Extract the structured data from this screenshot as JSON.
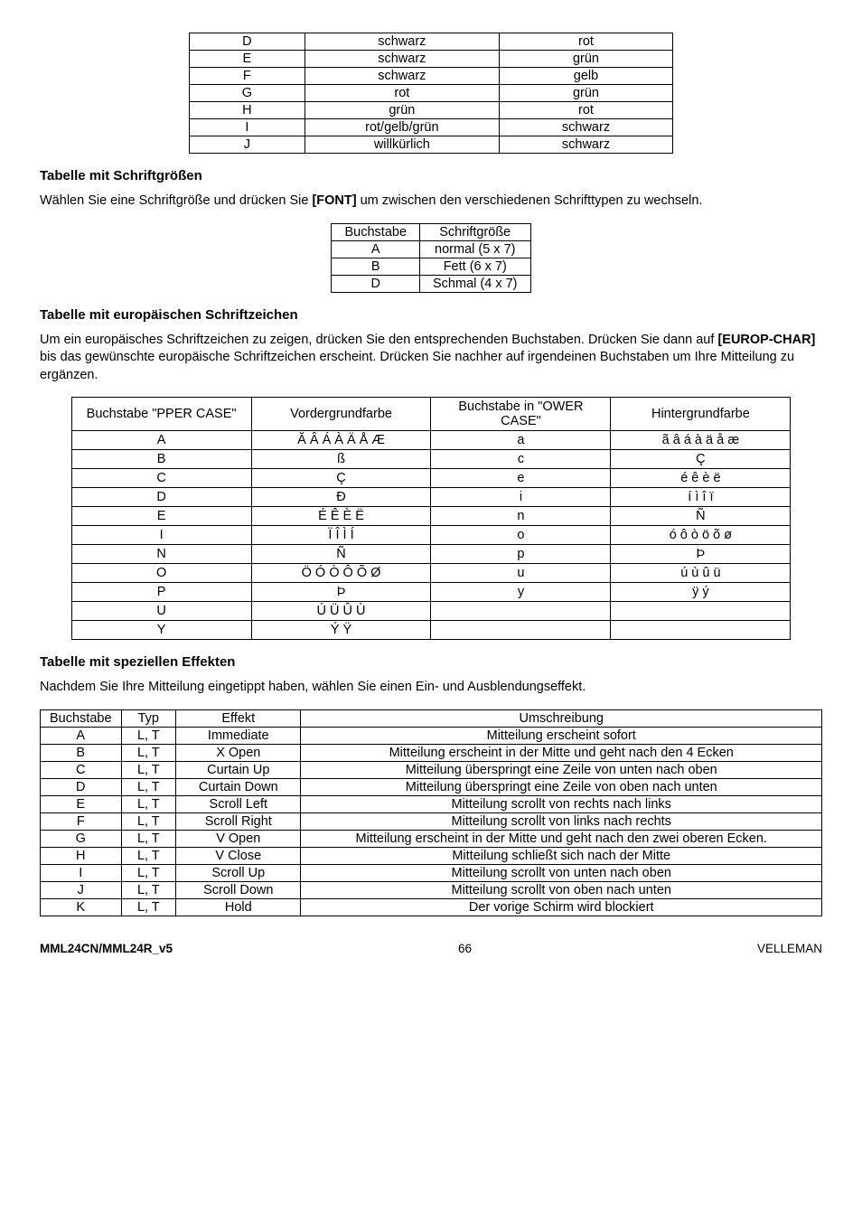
{
  "table1": {
    "rows": [
      [
        "D",
        "schwarz",
        "rot"
      ],
      [
        "E",
        "schwarz",
        "grün"
      ],
      [
        "F",
        "schwarz",
        "gelb"
      ],
      [
        "G",
        "rot",
        "grün"
      ],
      [
        "H",
        "grün",
        "rot"
      ],
      [
        "I",
        "rot/gelb/grün",
        "schwarz"
      ],
      [
        "J",
        "willkürlich",
        "schwarz"
      ]
    ]
  },
  "h1": "Tabelle mit Schriftgrößen",
  "p1a": "Wählen Sie eine Schriftgröße und drücken Sie ",
  "p1b": "[FONT]",
  "p1c": " um zwischen den verschiedenen Schrifttypen zu wechseln.",
  "table2": {
    "head": [
      "Buchstabe",
      "Schriftgröße"
    ],
    "rows": [
      [
        "A",
        "normal (5 x 7)"
      ],
      [
        "B",
        "Fett (6 x 7)"
      ],
      [
        "D",
        "Schmal (4 x 7)"
      ]
    ]
  },
  "h2": "Tabelle mit europäischen Schriftzeichen",
  "p2a": "Um ein europäisches Schriftzeichen zu zeigen, drücken Sie den entsprechenden Buchstaben. Drücken Sie dann auf ",
  "p2b": "[EUROP-CHAR]",
  "p2c": " bis das gewünschte europäische Schriftzeichen erscheint. Drücken Sie nachher auf irgendeinen Buchstaben um Ihre Mitteilung zu ergänzen.",
  "table3": {
    "head": [
      "Buchstabe \"PPER CASE\"",
      "Vordergrundfarbe",
      "Buchstabe in \"OWER CASE\"",
      "Hintergrundfarbe"
    ],
    "rows": [
      [
        "A",
        "Ă Â Á À Ä Å Æ",
        "a",
        "ã â á à ä å æ"
      ],
      [
        "B",
        "ß",
        "c",
        "Ç"
      ],
      [
        "C",
        "Ç",
        "e",
        "é ê è ë"
      ],
      [
        "D",
        "Ð",
        "i",
        "í ì î ï"
      ],
      [
        "E",
        "É Ê È Ë",
        "n",
        "Ñ"
      ],
      [
        "I",
        "Ï Î Ì Í",
        "o",
        "ó ô ò ö õ ø"
      ],
      [
        "N",
        "Ñ",
        "p",
        "Þ"
      ],
      [
        "O",
        "Ö Ó Ò Ô Õ Ø",
        "u",
        "ú ù û ü"
      ],
      [
        "P",
        "Þ",
        "y",
        "ÿ ý"
      ],
      [
        "U",
        "Ú Ü Û Ù",
        "",
        ""
      ],
      [
        "Y",
        "Ý Ÿ",
        "",
        ""
      ]
    ]
  },
  "h3": "Tabelle mit speziellen Effekten",
  "p3": "Nachdem Sie Ihre Mitteilung eingetippt haben, wählen Sie einen Ein- und Ausblendungseffekt.",
  "table4": {
    "head": [
      "Buchstabe",
      "Typ",
      "Effekt",
      "Umschreibung"
    ],
    "rows": [
      [
        "A",
        "L, T",
        "Immediate",
        "Mitteilung erscheint sofort"
      ],
      [
        "B",
        "L, T",
        "X Open",
        "Mitteilung erscheint in der Mitte und geht nach den 4 Ecken"
      ],
      [
        "C",
        "L, T",
        "Curtain Up",
        "Mitteilung überspringt eine Zeile von unten nach oben"
      ],
      [
        "D",
        "L, T",
        "Curtain Down",
        "Mitteilung überspringt eine Zeile von oben nach unten"
      ],
      [
        "E",
        "L, T",
        "Scroll Left",
        "Mitteilung scrollt von rechts nach links"
      ],
      [
        "F",
        "L, T",
        "Scroll Right",
        "Mitteilung scrollt von links nach rechts"
      ],
      [
        "G",
        "L, T",
        "V Open",
        "Mitteilung erscheint in der Mitte und geht nach den zwei oberen Ecken."
      ],
      [
        "H",
        "L, T",
        "V Close",
        "Mitteilung schließt sich nach der Mitte"
      ],
      [
        "I",
        "L, T",
        "Scroll Up",
        "Mitteilung scrollt von unten nach oben"
      ],
      [
        "J",
        "L, T",
        "Scroll Down",
        "Mitteilung scrollt von oben nach unten"
      ],
      [
        "K",
        "L, T",
        "Hold",
        "Der vorige Schirm wird blockiert"
      ]
    ]
  },
  "footer": {
    "left": "MML24CN/MML24R_v5",
    "center": "66",
    "right": "VELLEMAN"
  }
}
